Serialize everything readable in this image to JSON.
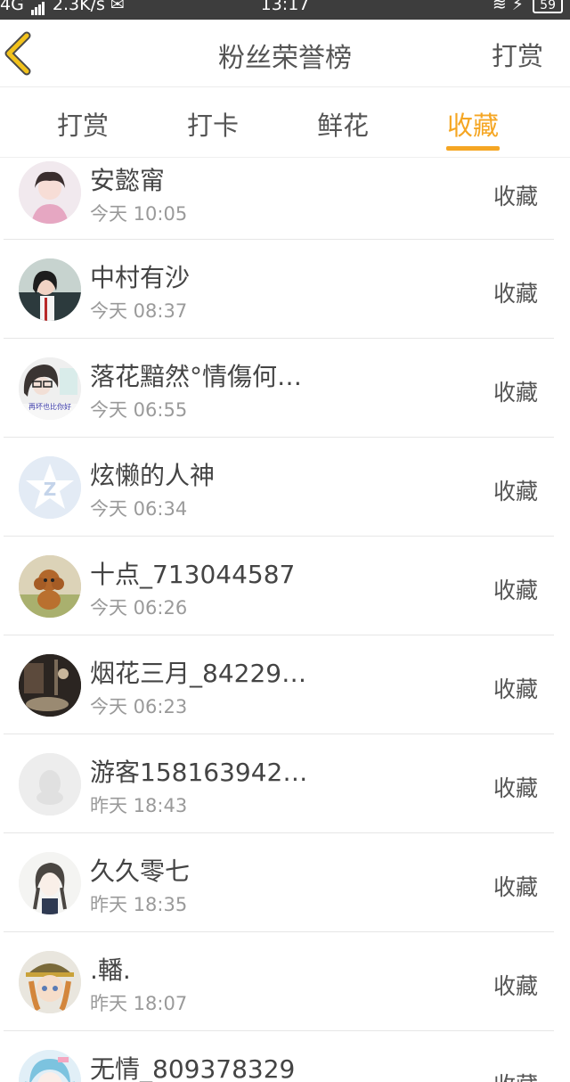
{
  "status_bar": {
    "network": "4G",
    "speed": "2.3K/s",
    "time": "13:17",
    "battery": "59"
  },
  "header": {
    "title": "粉丝荣誉榜",
    "action": "打赏"
  },
  "tabs": [
    {
      "label": "打赏",
      "active": false
    },
    {
      "label": "打卡",
      "active": false
    },
    {
      "label": "鲜花",
      "active": false
    },
    {
      "label": "收藏",
      "active": true
    }
  ],
  "list": [
    {
      "name": "安懿甯",
      "time": "今天 10:05",
      "action": "收藏",
      "avatar": "portrait-girl-pink"
    },
    {
      "name": "中村有沙",
      "time": "今天 08:37",
      "action": "收藏",
      "avatar": "portrait-dark-hair"
    },
    {
      "name": "落花黯然°情傷何…",
      "time": "今天 06:55",
      "action": "收藏",
      "avatar": "portrait-glasses",
      "avatar_text": "再坏也比你好"
    },
    {
      "name": "炫懒的人神",
      "time": "今天 06:34",
      "action": "收藏",
      "avatar": "default-star-avatar"
    },
    {
      "name": "十点_713044587",
      "time": "今天 06:26",
      "action": "收藏",
      "avatar": "poodle-photo"
    },
    {
      "name": "烟花三月_84229…",
      "time": "今天 06:23",
      "action": "收藏",
      "avatar": "dark-scene-photo"
    },
    {
      "name": "游客158163942…",
      "time": "昨天 18:43",
      "action": "收藏",
      "avatar": "default-penguin-avatar"
    },
    {
      "name": "久久零七",
      "time": "昨天 18:35",
      "action": "收藏",
      "avatar": "anime-girl-sketch"
    },
    {
      "name": ".轓.",
      "time": "昨天 18:07",
      "action": "收藏",
      "avatar": "anime-girl-hat"
    },
    {
      "name": "无情_809378329",
      "time": "",
      "action": "收藏",
      "avatar": "anime-blue-hair"
    }
  ],
  "colors": {
    "accent": "#f5a623",
    "text": "#444444",
    "subtext": "#9a9a9a",
    "divider": "#e6e6e6"
  }
}
